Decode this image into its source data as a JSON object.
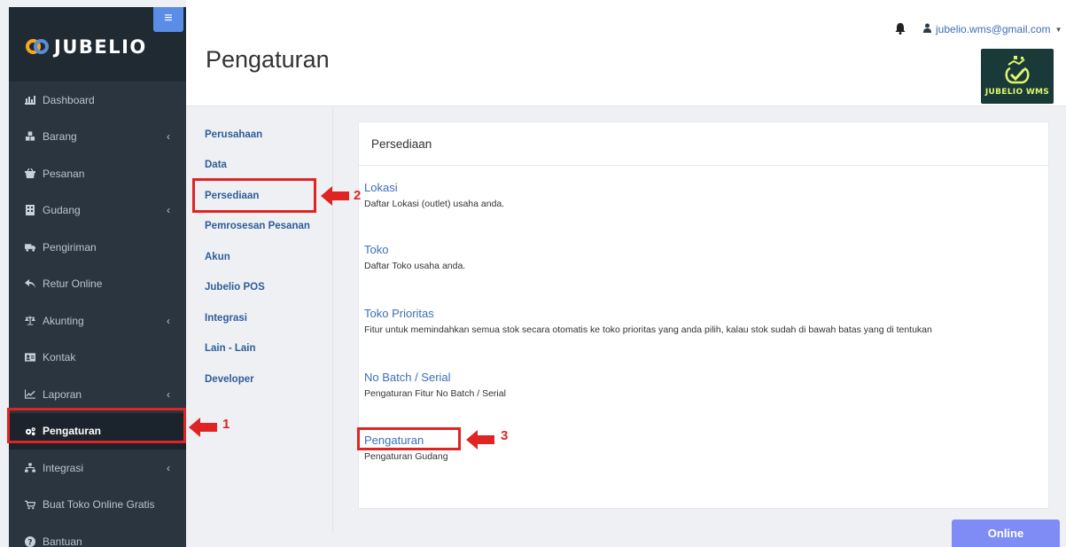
{
  "brand": {
    "name": "JUBELIO"
  },
  "header": {
    "title": "Pengaturan",
    "user_email": "jubelio.wms@gmail.com",
    "logo_text": "JUBELIO WMS"
  },
  "sidebar": {
    "items": [
      {
        "label": "Dashboard",
        "icon": "chart-icon",
        "has_children": false
      },
      {
        "label": "Barang",
        "icon": "cubes-icon",
        "has_children": true
      },
      {
        "label": "Pesanan",
        "icon": "basket-icon",
        "has_children": false
      },
      {
        "label": "Gudang",
        "icon": "building-icon",
        "has_children": true
      },
      {
        "label": "Pengiriman",
        "icon": "truck-icon",
        "has_children": false
      },
      {
        "label": "Retur Online",
        "icon": "reply-icon",
        "has_children": false
      },
      {
        "label": "Akunting",
        "icon": "balance-icon",
        "has_children": true
      },
      {
        "label": "Kontak",
        "icon": "contact-card-icon",
        "has_children": false
      },
      {
        "label": "Laporan",
        "icon": "line-chart-icon",
        "has_children": true
      },
      {
        "label": "Pengaturan",
        "icon": "gears-icon",
        "has_children": false,
        "active": true
      },
      {
        "label": "Integrasi",
        "icon": "sitemap-icon",
        "has_children": true
      },
      {
        "label": "Buat Toko Online Gratis",
        "icon": "cart-icon",
        "has_children": false
      },
      {
        "label": "Bantuan",
        "icon": "question-icon",
        "has_children": false
      }
    ]
  },
  "settings_nav": {
    "items": [
      "Perusahaan",
      "Data",
      "Persediaan",
      "Pemrosesan Pesanan",
      "Akun",
      "Jubelio POS",
      "Integrasi",
      "Lain - Lain",
      "Developer"
    ]
  },
  "card": {
    "title": "Persediaan",
    "entries": [
      {
        "link": "Lokasi",
        "desc": "Daftar Lokasi (outlet) usaha anda."
      },
      {
        "link": "Toko",
        "desc": "Daftar Toko usaha anda."
      },
      {
        "link": "Toko Prioritas",
        "desc": "Fitur untuk memindahkan semua stok secara otomatis ke toko prioritas yang anda pilih, kalau stok sudah di bawah batas yang di tentukan"
      },
      {
        "link": "No Batch / Serial",
        "desc": "Pengaturan Fitur No Batch / Serial"
      },
      {
        "link": "Pengaturan",
        "desc": "Pengaturan Gudang"
      }
    ]
  },
  "annotations": {
    "n1": "1",
    "n2": "2",
    "n3": "3",
    "color": "#e02424"
  },
  "online_button": "Online"
}
